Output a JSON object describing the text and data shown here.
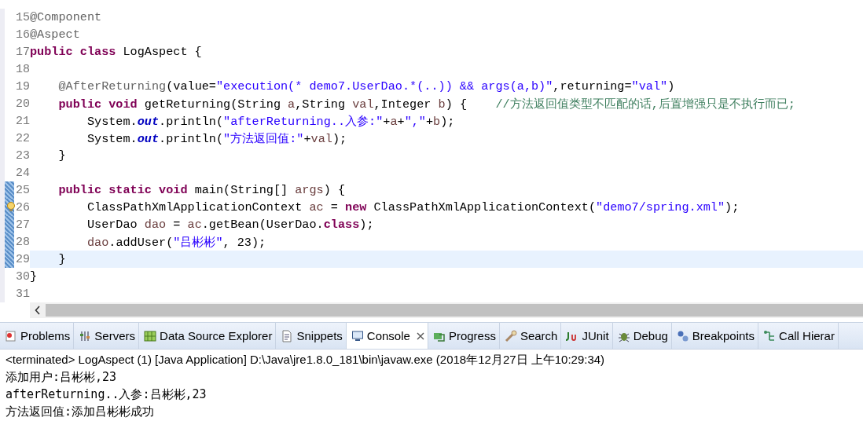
{
  "editor": {
    "lines": [
      {
        "number": "15",
        "changed": false,
        "current": false,
        "warning": false,
        "tokens": [
          {
            "kind": "annotation",
            "text": "@Component"
          }
        ]
      },
      {
        "number": "16",
        "changed": false,
        "current": false,
        "warning": false,
        "tokens": [
          {
            "kind": "annotation",
            "text": "@Aspect"
          }
        ]
      },
      {
        "number": "17",
        "changed": false,
        "current": false,
        "warning": false,
        "tokens": [
          {
            "kind": "keyword",
            "text": "public class "
          },
          {
            "kind": "plain",
            "text": "LogAspect {"
          }
        ]
      },
      {
        "number": "18",
        "changed": false,
        "current": false,
        "warning": false
      },
      {
        "number": "19",
        "changed": false,
        "current": false,
        "warning": false,
        "tokens": [
          {
            "kind": "annotation",
            "text": "    @AfterReturning"
          },
          {
            "kind": "plain",
            "text": "(value="
          },
          {
            "kind": "string",
            "text": "\"execution(* demo7.UserDao.*(..)) && args(a,b)\""
          },
          {
            "kind": "plain",
            "text": ",returning="
          },
          {
            "kind": "string",
            "text": "\"val\""
          },
          {
            "kind": "plain",
            "text": ")"
          }
        ]
      },
      {
        "number": "20",
        "changed": false,
        "current": false,
        "warning": false,
        "tokens": [
          {
            "kind": "keyword",
            "text": "    public void "
          },
          {
            "kind": "plain",
            "text": "getReturning(String "
          },
          {
            "kind": "variable",
            "text": "a"
          },
          {
            "kind": "plain",
            "text": ",String "
          },
          {
            "kind": "variable",
            "text": "val"
          },
          {
            "kind": "plain",
            "text": ",Integer "
          },
          {
            "kind": "variable",
            "text": "b"
          },
          {
            "kind": "plain",
            "text": ") {    "
          },
          {
            "kind": "comment",
            "text": "//方法返回值类型不匹配的话,后置增强只是不执行而已;"
          }
        ]
      },
      {
        "number": "21",
        "changed": false,
        "current": false,
        "warning": false,
        "tokens": [
          {
            "kind": "plain",
            "text": "        System."
          },
          {
            "kind": "field",
            "text": "out"
          },
          {
            "kind": "plain",
            "text": ".println("
          },
          {
            "kind": "string",
            "text": "\"afterReturning..入参:\""
          },
          {
            "kind": "plain",
            "text": "+"
          },
          {
            "kind": "variable",
            "text": "a"
          },
          {
            "kind": "plain",
            "text": "+"
          },
          {
            "kind": "string",
            "text": "\",\""
          },
          {
            "kind": "plain",
            "text": "+"
          },
          {
            "kind": "variable",
            "text": "b"
          },
          {
            "kind": "plain",
            "text": ");"
          }
        ]
      },
      {
        "number": "22",
        "changed": false,
        "current": false,
        "warning": false,
        "tokens": [
          {
            "kind": "plain",
            "text": "        System."
          },
          {
            "kind": "field",
            "text": "out"
          },
          {
            "kind": "plain",
            "text": ".println("
          },
          {
            "kind": "string",
            "text": "\"方法返回值:\""
          },
          {
            "kind": "plain",
            "text": "+"
          },
          {
            "kind": "variable",
            "text": "val"
          },
          {
            "kind": "plain",
            "text": ");"
          }
        ]
      },
      {
        "number": "23",
        "changed": false,
        "current": false,
        "warning": false,
        "tokens": [
          {
            "kind": "plain",
            "text": "    }"
          }
        ]
      },
      {
        "number": "24",
        "changed": false,
        "current": false,
        "warning": false
      },
      {
        "number": "25",
        "changed": true,
        "current": false,
        "warning": false,
        "tokens": [
          {
            "kind": "keyword",
            "text": "    public static void "
          },
          {
            "kind": "plain",
            "text": "main(String[] "
          },
          {
            "kind": "variable",
            "text": "args"
          },
          {
            "kind": "plain",
            "text": ") {"
          }
        ]
      },
      {
        "number": "26",
        "changed": true,
        "current": false,
        "warning": true,
        "tokens": [
          {
            "kind": "plain",
            "text": "        ClassPathXmlApplicationContext "
          },
          {
            "kind": "variable",
            "text": "ac"
          },
          {
            "kind": "plain",
            "text": " = "
          },
          {
            "kind": "keyword",
            "text": "new "
          },
          {
            "kind": "plain",
            "text": "ClassPathXmlApplicationContext("
          },
          {
            "kind": "string",
            "text": "\"demo7/spring.xml\""
          },
          {
            "kind": "plain",
            "text": ");"
          }
        ]
      },
      {
        "number": "27",
        "changed": true,
        "current": false,
        "warning": false,
        "tokens": [
          {
            "kind": "plain",
            "text": "        UserDao "
          },
          {
            "kind": "variable",
            "text": "dao"
          },
          {
            "kind": "plain",
            "text": " = "
          },
          {
            "kind": "variable",
            "text": "ac"
          },
          {
            "kind": "plain",
            "text": ".getBean(UserDao."
          },
          {
            "kind": "keyword",
            "text": "class"
          },
          {
            "kind": "plain",
            "text": ");"
          }
        ]
      },
      {
        "number": "28",
        "changed": true,
        "current": false,
        "warning": false,
        "tokens": [
          {
            "kind": "variable",
            "text": "        dao"
          },
          {
            "kind": "plain",
            "text": ".addUser("
          },
          {
            "kind": "string",
            "text": "\"吕彬彬\""
          },
          {
            "kind": "plain",
            "text": ", 23);"
          }
        ]
      },
      {
        "number": "29",
        "changed": true,
        "current": true,
        "warning": false,
        "tokens": [
          {
            "kind": "plain",
            "text": "    }"
          }
        ]
      },
      {
        "number": "30",
        "changed": false,
        "current": false,
        "warning": false,
        "tokens": [
          {
            "kind": "plain",
            "text": "}"
          }
        ]
      },
      {
        "number": "31",
        "changed": false,
        "current": false,
        "warning": false
      }
    ]
  },
  "tabs": [
    {
      "label": "Problems",
      "selected": false
    },
    {
      "label": "Servers",
      "selected": false
    },
    {
      "label": "Data Source Explorer",
      "selected": false
    },
    {
      "label": "Snippets",
      "selected": false
    },
    {
      "label": "Console",
      "selected": true
    },
    {
      "label": "Progress",
      "selected": false
    },
    {
      "label": "Search",
      "selected": false
    },
    {
      "label": "JUnit",
      "selected": false
    },
    {
      "label": "Debug",
      "selected": false
    },
    {
      "label": "Breakpoints",
      "selected": false
    },
    {
      "label": "Call Hierar",
      "selected": false
    }
  ],
  "console": {
    "header": "<terminated> LogAspect (1) [Java Application] D:\\Java\\jre1.8.0_181\\bin\\javaw.exe (2018年12月27日 上午10:29:34)",
    "output": [
      "添加用户:吕彬彬,23",
      "afterReturning..入参:吕彬彬,23",
      "方法返回值:添加吕彬彬成功"
    ]
  }
}
